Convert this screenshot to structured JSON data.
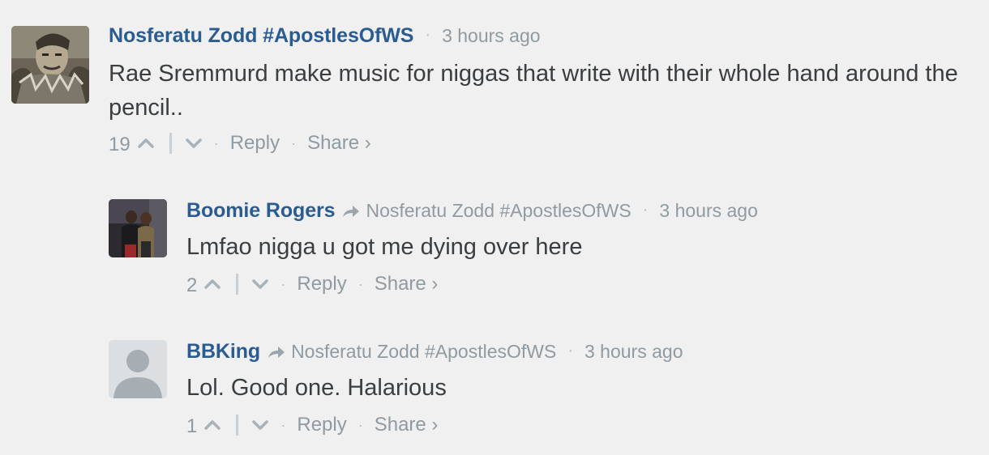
{
  "comments": [
    {
      "author": "Nosferatu Zodd #ApostlesOfWS",
      "time": "3 hours ago",
      "message": "Rae Sremmurd make music for niggas that write with their whole hand around the pencil..",
      "votes": "19",
      "reply_label": "Reply",
      "share_label": "Share ›"
    },
    {
      "author": "Boomie Rogers",
      "reply_to": "Nosferatu Zodd #ApostlesOfWS",
      "time": "3 hours ago",
      "message": "Lmfao nigga u got me dying over here",
      "votes": "2",
      "reply_label": "Reply",
      "share_label": "Share ›"
    },
    {
      "author": "BBKing",
      "reply_to": "Nosferatu Zodd #ApostlesOfWS",
      "time": "3 hours ago",
      "message": "Lol. Good one. Halarious",
      "votes": "1",
      "reply_label": "Reply",
      "share_label": "Share ›"
    }
  ],
  "separator": "·",
  "icons": {
    "upvote": "chevron-up-icon",
    "downvote": "chevron-down-icon",
    "reply_to": "reply-arrow-icon"
  },
  "colors": {
    "author": "#2a5c92",
    "meta": "#8f9aa1",
    "text": "#3a3e41",
    "background": "#f0f0f0"
  }
}
